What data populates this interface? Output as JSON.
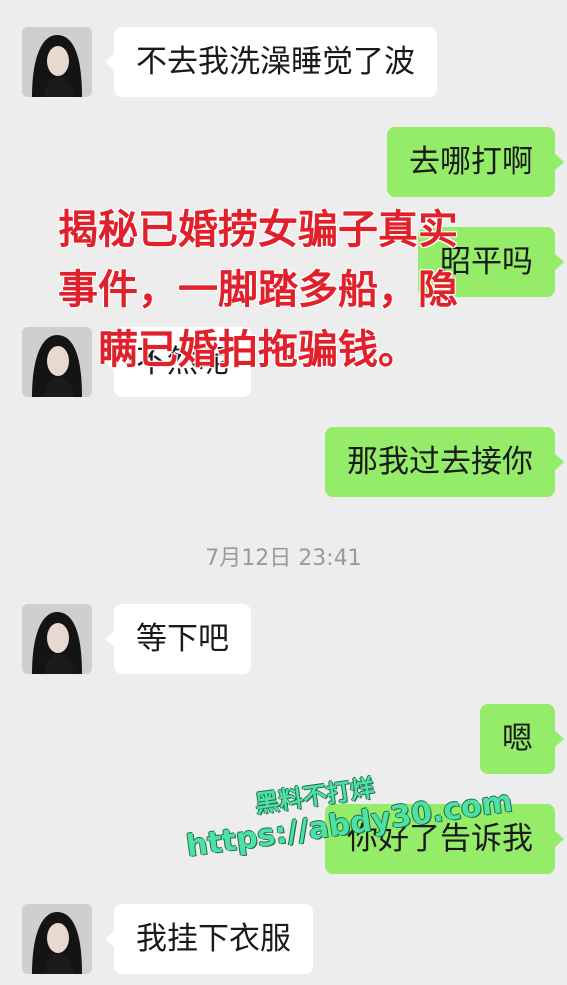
{
  "messages": [
    {
      "side": "in",
      "text": "不去我洗澡睡觉了波"
    },
    {
      "side": "out",
      "text": "去哪打啊"
    },
    {
      "side": "out",
      "text": "昭平吗"
    },
    {
      "side": "in",
      "text": "不然呢"
    },
    {
      "side": "out",
      "text": "那我过去接你"
    },
    {
      "side": "in",
      "text": "等下吧"
    },
    {
      "side": "out",
      "text": "嗯"
    },
    {
      "side": "out",
      "text": "你好了告诉我"
    },
    {
      "side": "in",
      "text": "我挂下衣服"
    }
  ],
  "timestamp": "7月12日 23:41",
  "overlay_text": "揭秘已婚捞女骗子真实事件，一脚踏多船，隐瞒已婚拍拖骗钱。",
  "watermark": {
    "line1": "黑料不打烊",
    "line2": "https://abdy30.com"
  },
  "colors": {
    "background": "#ededed",
    "incoming_bubble": "#ffffff",
    "outgoing_bubble": "#95ec69",
    "overlay_text": "#e0202a",
    "watermark": "#4fe0a4"
  }
}
